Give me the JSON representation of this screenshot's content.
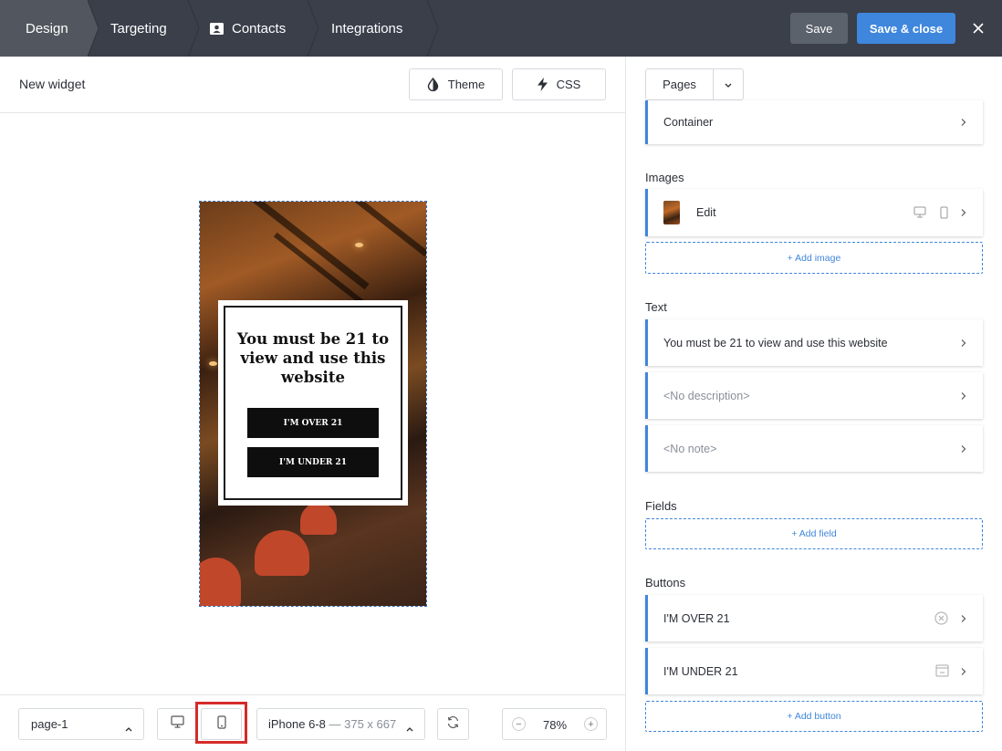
{
  "topbar": {
    "crumbs": [
      "Design",
      "Targeting",
      "Contacts",
      "Integrations"
    ],
    "save_label": "Save",
    "save_close_label": "Save & close"
  },
  "editor": {
    "widget_title": "New widget",
    "theme_label": "Theme",
    "css_label": "CSS"
  },
  "preview": {
    "modal_title": "You must be 21 to view and use this website",
    "button_over": "I'M OVER 21",
    "button_under": "I'M UNDER 21"
  },
  "bottombar": {
    "page_select": "page-1",
    "device_name": "iPhone 6-8",
    "device_dims": "— 375 x 667",
    "zoom": "78%",
    "zoom_minus": "−",
    "zoom_plus": "+"
  },
  "panel": {
    "pages_label": "Pages",
    "container_label": "Container",
    "images_heading": "Images",
    "image_item": "Edit",
    "add_image": "+ Add image",
    "text_heading": "Text",
    "text_items": [
      "You must be 21 to view and use this website",
      "<No description>",
      "<No note>"
    ],
    "fields_heading": "Fields",
    "add_field": "+ Add field",
    "buttons_heading": "Buttons",
    "button_items": [
      "I'M OVER 21",
      "I'M UNDER 21"
    ],
    "add_button": "+ Add button"
  },
  "colors": {
    "topbar": "#3a3f4a",
    "active_crumb": "#52575f",
    "accent": "#3f86dd",
    "highlight": "#d62a2a"
  }
}
